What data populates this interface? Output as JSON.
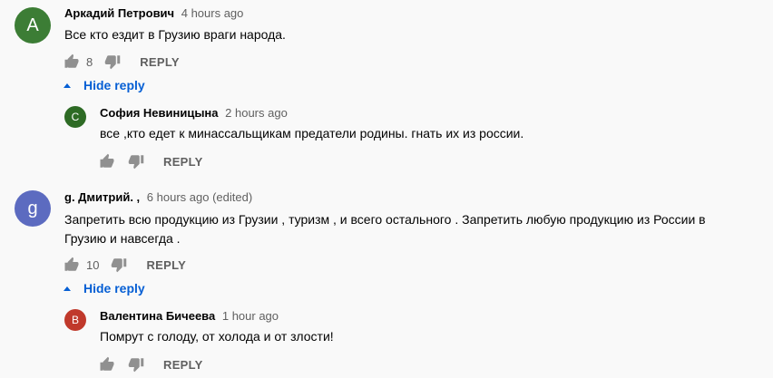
{
  "colors": {
    "avatar_a": "#3c7d35",
    "avatar_c": "#2e6b25",
    "avatar_g": "#5c6bc0",
    "avatar_v": "#c0392b",
    "link": "#065fd4"
  },
  "comments": [
    {
      "avatar_letter": "A",
      "author": "Аркадий Петрович",
      "time": "4 hours ago",
      "text": "Все кто ездит в Грузию враги народа.",
      "likes": "8",
      "reply_label": "REPLY",
      "hide_reply_label": "Hide reply",
      "reply": {
        "avatar_letter": "С",
        "author": "София Невиницына",
        "time": "2 hours ago",
        "text": "все ,кто едет к минассальщикам предатели родины. гнать их из россии.",
        "reply_label": "REPLY"
      }
    },
    {
      "avatar_letter": "g",
      "author": "g. Дмитрий. ,",
      "time": "6 hours ago (edited)",
      "text_line1": "Запретить всю продукцию из Грузии , туризм , и всего остального . Запретить любую продукцию из России в",
      "text_line2": "Грузию и навсегда .",
      "likes": "10",
      "reply_label": "REPLY",
      "hide_reply_label": "Hide reply",
      "reply": {
        "avatar_letter": "В",
        "author": "Валентина Бичеева",
        "time": "1 hour ago",
        "text": "Помрут с голоду, от холода и от злости!",
        "reply_label": "REPLY"
      }
    }
  ]
}
